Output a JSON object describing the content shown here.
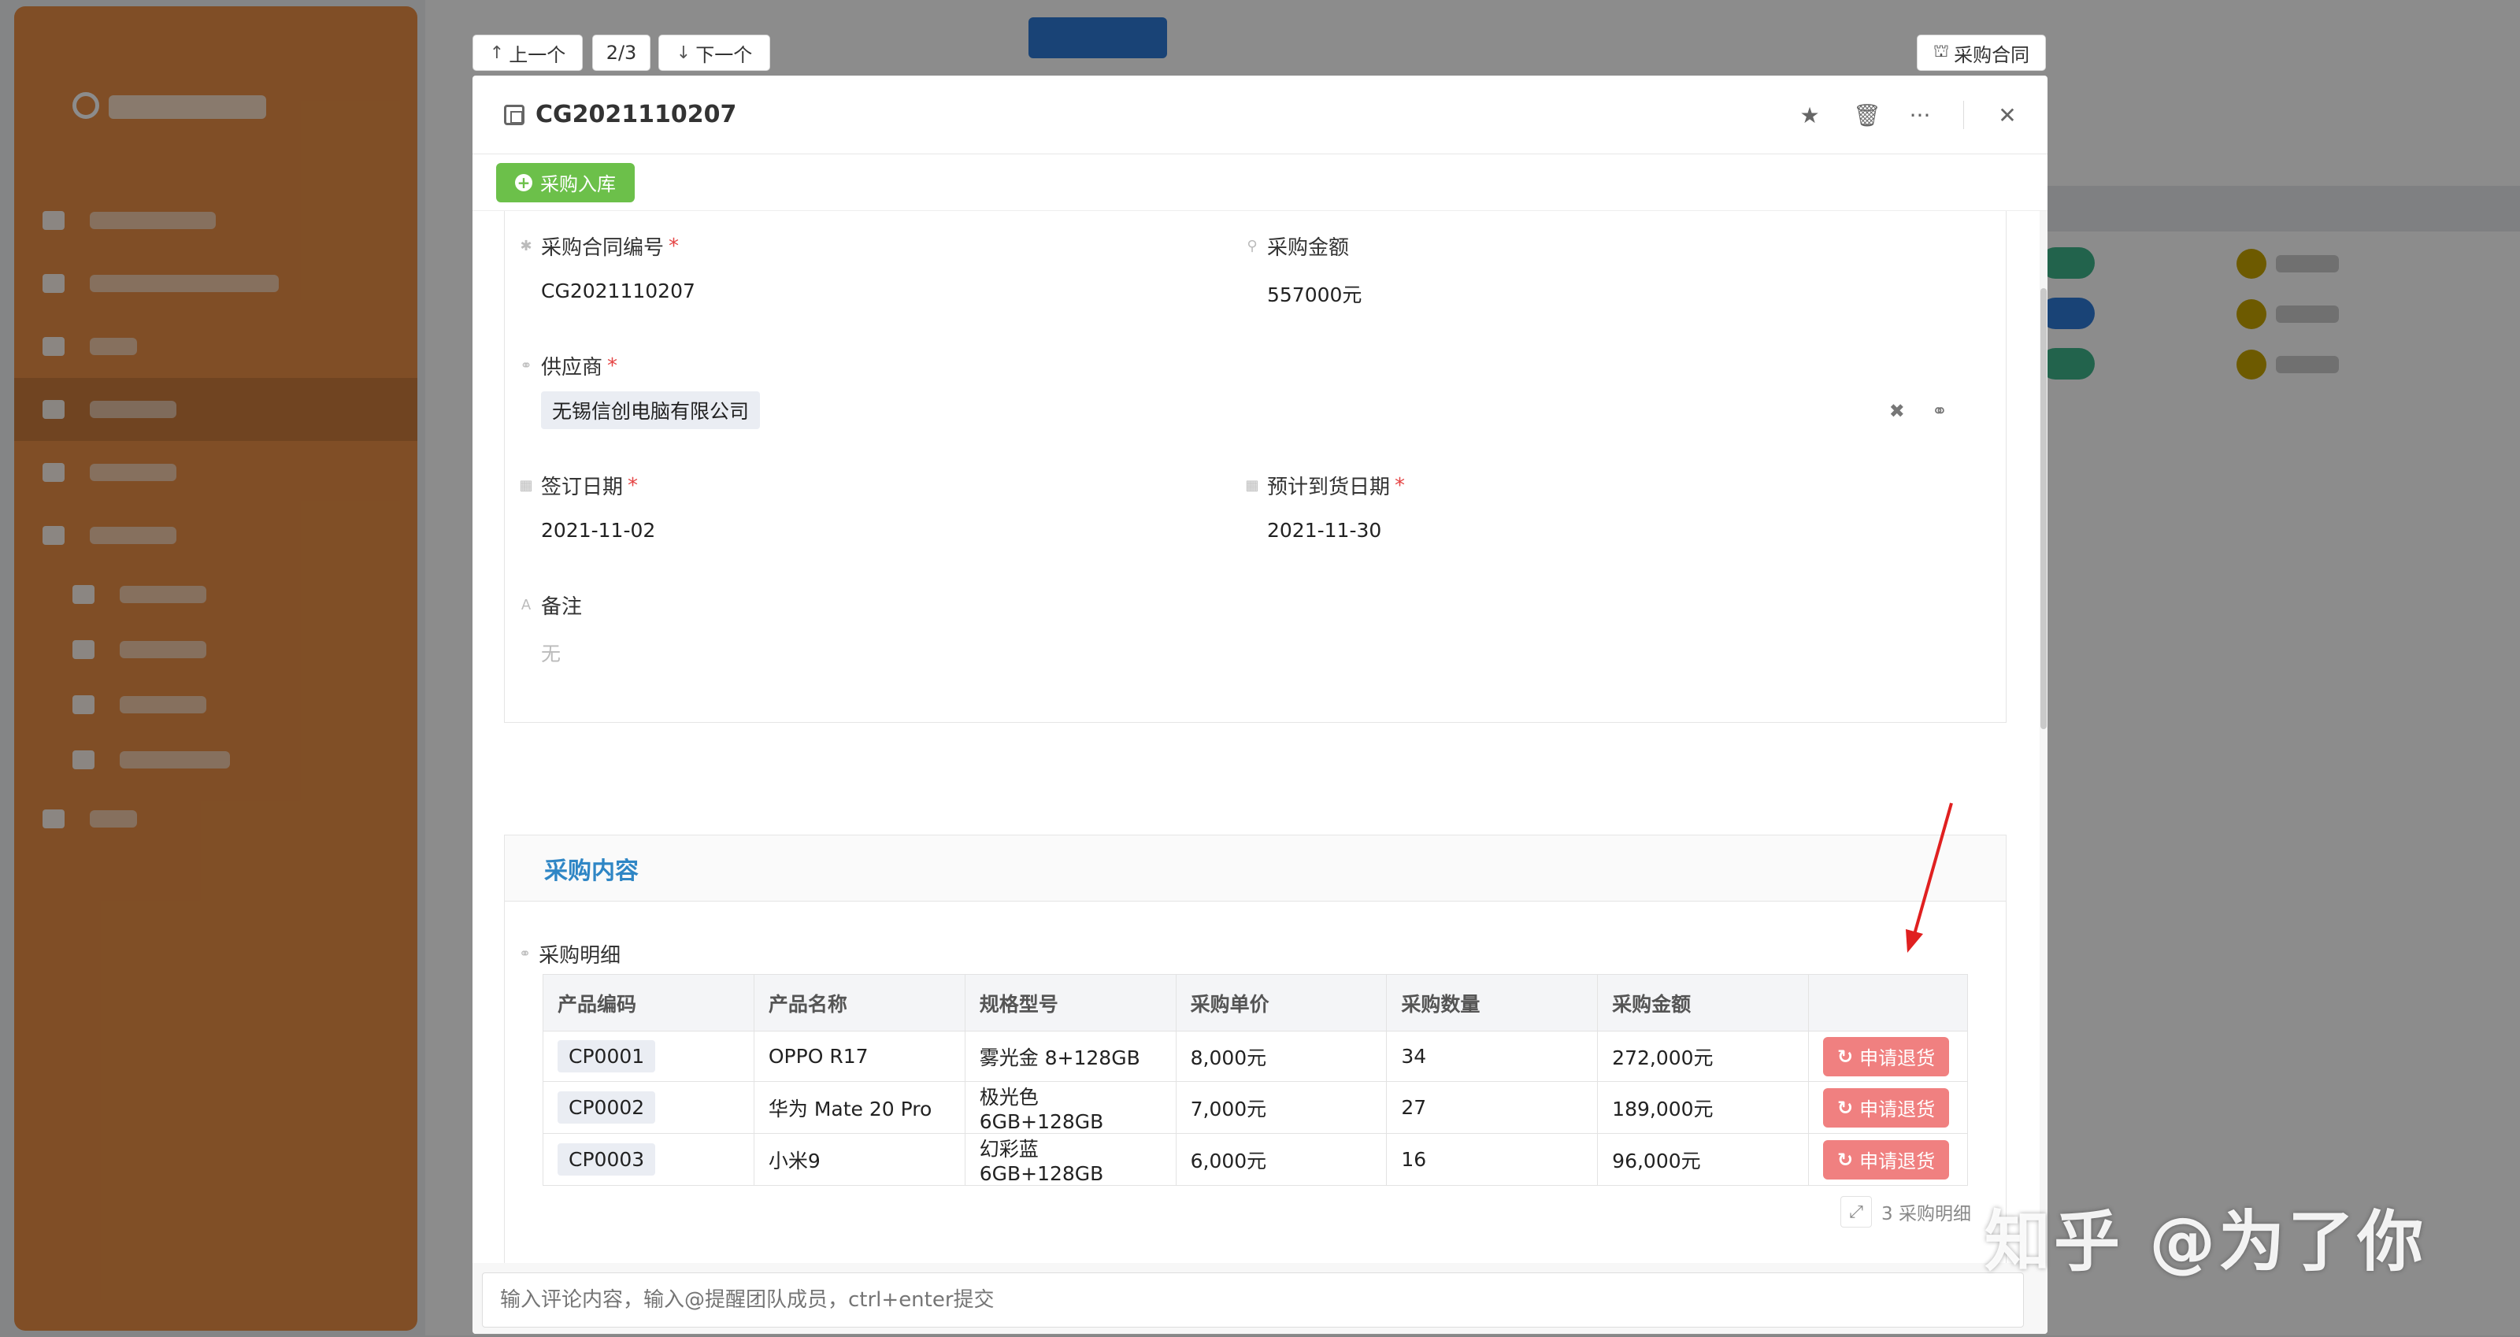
{
  "nav": {
    "prev_label": "上一个",
    "page_indicator": "2/3",
    "next_label": "下一个",
    "contract_link_label": "采购合同"
  },
  "modal": {
    "title": "CG2021110207",
    "toolbar": {
      "stock_in_label": "采购入库"
    },
    "fields": {
      "contract_no": {
        "label": "采购合同编号",
        "value": "CG2021110207",
        "required": true
      },
      "amount": {
        "label": "采购金额",
        "value": "557000元"
      },
      "supplier": {
        "label": "供应商",
        "value": "无锡信创电脑有限公司",
        "required": true
      },
      "sign_date": {
        "label": "签订日期",
        "value": "2021-11-02",
        "required": true
      },
      "delivery_date": {
        "label": "预计到货日期",
        "value": "2021-11-30",
        "required": true
      },
      "remark": {
        "label": "备注",
        "value": "无"
      }
    },
    "content_section": {
      "title": "采购内容",
      "detail_label": "采购明细",
      "columns": [
        "产品编码",
        "产品名称",
        "规格型号",
        "采购单价",
        "采购数量",
        "采购金额",
        ""
      ],
      "rows": [
        {
          "code": "CP0001",
          "name": "OPPO R17",
          "spec": "雾光金 8+128GB",
          "unit_price": "8,000元",
          "qty": "34",
          "amount": "272,000元",
          "action": "申请退货"
        },
        {
          "code": "CP0002",
          "name": "华为 Mate 20 Pro",
          "spec": "极光色 6GB+128GB",
          "unit_price": "7,000元",
          "qty": "27",
          "amount": "189,000元",
          "action": "申请退货"
        },
        {
          "code": "CP0003",
          "name": "小米9",
          "spec": "幻彩蓝 6GB+128GB",
          "unit_price": "6,000元",
          "qty": "16",
          "amount": "96,000元",
          "action": "申请退货"
        }
      ],
      "row_count_label": "3 采购明细"
    },
    "comment": {
      "placeholder": "输入评论内容，输入@提醒团队成员，ctrl+enter提交"
    }
  },
  "colors": {
    "sidebar": "#e98f45",
    "green_button": "#6cc04a",
    "return_button": "#f08080",
    "section_title": "#2f86c5",
    "required": "#e54545"
  },
  "icons": {
    "title": "copy-icon",
    "favorite": "star-icon",
    "delete": "trash-icon",
    "more": "more-icon",
    "close": "close-icon",
    "return": "refresh-icon",
    "expand": "expand-icon"
  },
  "watermark": "知乎 @为了你"
}
